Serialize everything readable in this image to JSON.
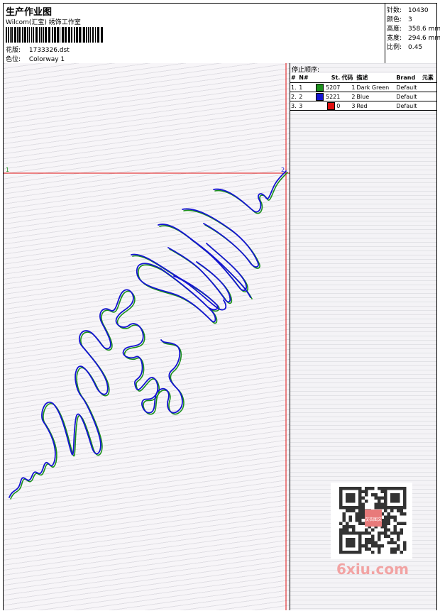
{
  "header": {
    "title": "生产作业图",
    "subtitle": "Wilcom(汇宝) 绣饰工作室",
    "design": {
      "label": "花版:",
      "value": "1733326.dst"
    },
    "colorway": {
      "label": "色位:",
      "value": "Colorway 1"
    }
  },
  "stats": [
    {
      "label": "针数:",
      "value": "10430"
    },
    {
      "label": "颜色:",
      "value": "3"
    },
    {
      "label": "高度:",
      "value": "358.6 mm"
    },
    {
      "label": "宽度:",
      "value": "294.6 mm"
    },
    {
      "label": "比例:",
      "value": "0.45"
    }
  ],
  "panel": {
    "title": "停止顺序:",
    "columns": [
      "#",
      "N#",
      "St.",
      "代码",
      "描述",
      "Brand",
      "元素"
    ],
    "rows": [
      {
        "idx": "1.",
        "n": "1",
        "color": "#1a8f1a",
        "code": "5207",
        "st": "1",
        "desc": "Dark Green",
        "brand": "Default"
      },
      {
        "idx": "2.",
        "n": "2",
        "color": "#1414d2",
        "code": "5221",
        "st": "2",
        "desc": "Blue",
        "brand": "Default"
      },
      {
        "idx": "3.",
        "n": "3",
        "color": "#e01010",
        "code": "0",
        "st": "3",
        "desc": "Red",
        "brand": "Default"
      }
    ]
  },
  "markers": {
    "start": "1",
    "end": "2"
  },
  "watermark": {
    "text": "6xiu.com",
    "stamp": "汉衣图文"
  },
  "colors": {
    "green": "#1a8f1a",
    "blue": "#1414d2",
    "red": "#e01010"
  }
}
